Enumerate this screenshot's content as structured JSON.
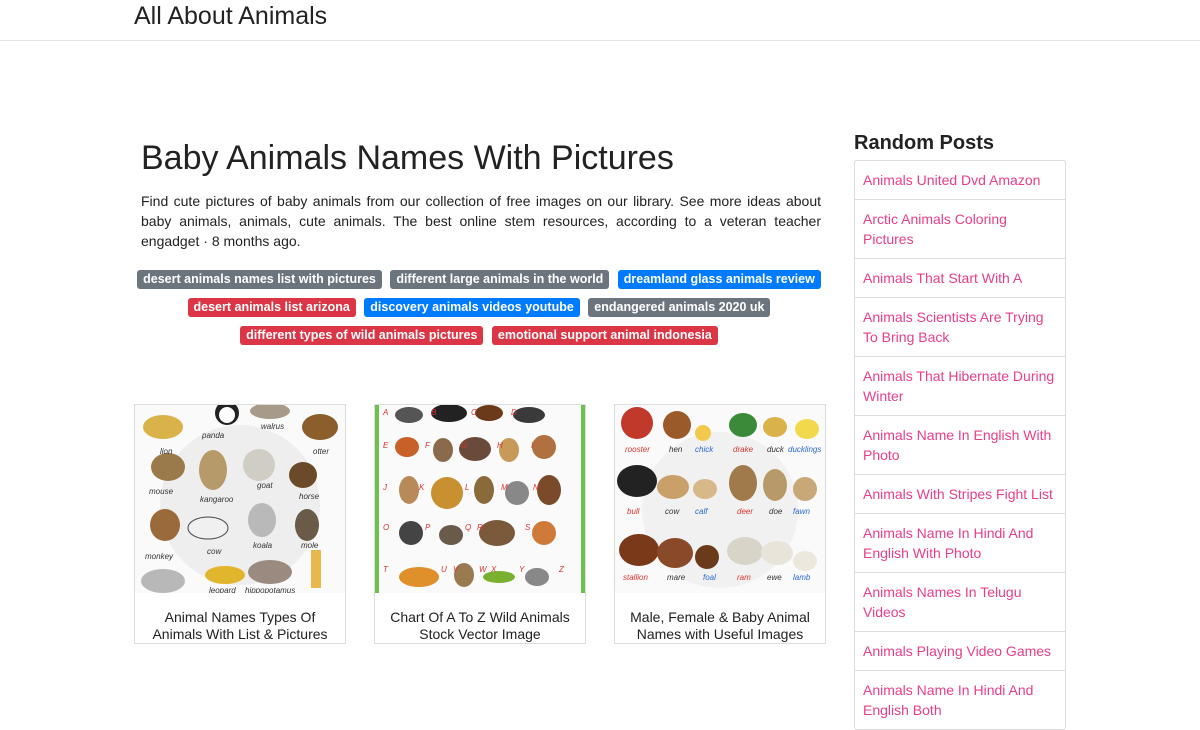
{
  "site": {
    "brand": "All About Animals"
  },
  "article": {
    "title": "Baby Animals Names With Pictures",
    "description": "Find cute pictures of baby animals from our collection of free images on our library. See more ideas about baby animals, animals, cute animals. The best online stem resources, according to a veteran teacher engadget · 8 months ago."
  },
  "tags": [
    {
      "label": "desert animals names list with pictures",
      "color": "#6c757d"
    },
    {
      "label": "different large animals in the world",
      "color": "#6c757d"
    },
    {
      "label": "dreamland glass animals review",
      "color": "#007bff"
    },
    {
      "label": "desert animals list arizona",
      "color": "#dc3545"
    },
    {
      "label": "discovery animals videos youtube",
      "color": "#007bff"
    },
    {
      "label": "endangered animals 2020 uk",
      "color": "#6c757d"
    },
    {
      "label": "different types of wild animals pictures",
      "color": "#dc3545"
    },
    {
      "label": "emotional support animal indonesia",
      "color": "#dc3545"
    }
  ],
  "cards": [
    {
      "caption": "Animal Names Types Of Animals With List & Pictures",
      "labels": [
        "panda",
        "walrus",
        "lion",
        "otter",
        "mouse",
        "kangaroo",
        "goat",
        "horse",
        "monkey",
        "cow",
        "koala",
        "mole",
        "leopard",
        "hippopotamus"
      ]
    },
    {
      "caption": "Chart Of A To Z Wild Animals Stock Vector Image",
      "labels": [
        "A",
        "B",
        "C",
        "D",
        "E",
        "F",
        "G",
        "H",
        "I",
        "J",
        "K",
        "L",
        "M",
        "N",
        "O",
        "P",
        "Q",
        "R",
        "S",
        "T",
        "U",
        "V",
        "W",
        "X",
        "Y",
        "Z"
      ]
    },
    {
      "caption": "Male, Female & Baby Animal Names with Useful Images",
      "labels": [
        "rooster",
        "hen",
        "chick",
        "drake",
        "duck",
        "ducklings",
        "bull",
        "cow",
        "calf",
        "deer",
        "doe",
        "fawn",
        "stallion",
        "mare",
        "foal",
        "ram",
        "ewe",
        "lamb"
      ]
    }
  ],
  "sidebar": {
    "title": "Random Posts",
    "items": [
      "Animals United Dvd Amazon",
      "Arctic Animals Coloring Pictures",
      "Animals That Start With A",
      "Animals Scientists Are Trying To Bring Back",
      "Animals That Hibernate During Winter",
      "Animals Name In English With Photo",
      "Animals With Stripes Fight List",
      "Animals Name In Hindi And English With Photo",
      "Animals Names In Telugu Videos",
      "Animals Playing Video Games",
      "Animals Name In Hindi And English Both"
    ]
  },
  "colors": {
    "link": "#e83e8c",
    "tag_gray": "#6c757d",
    "tag_blue": "#007bff",
    "tag_red": "#dc3545"
  }
}
